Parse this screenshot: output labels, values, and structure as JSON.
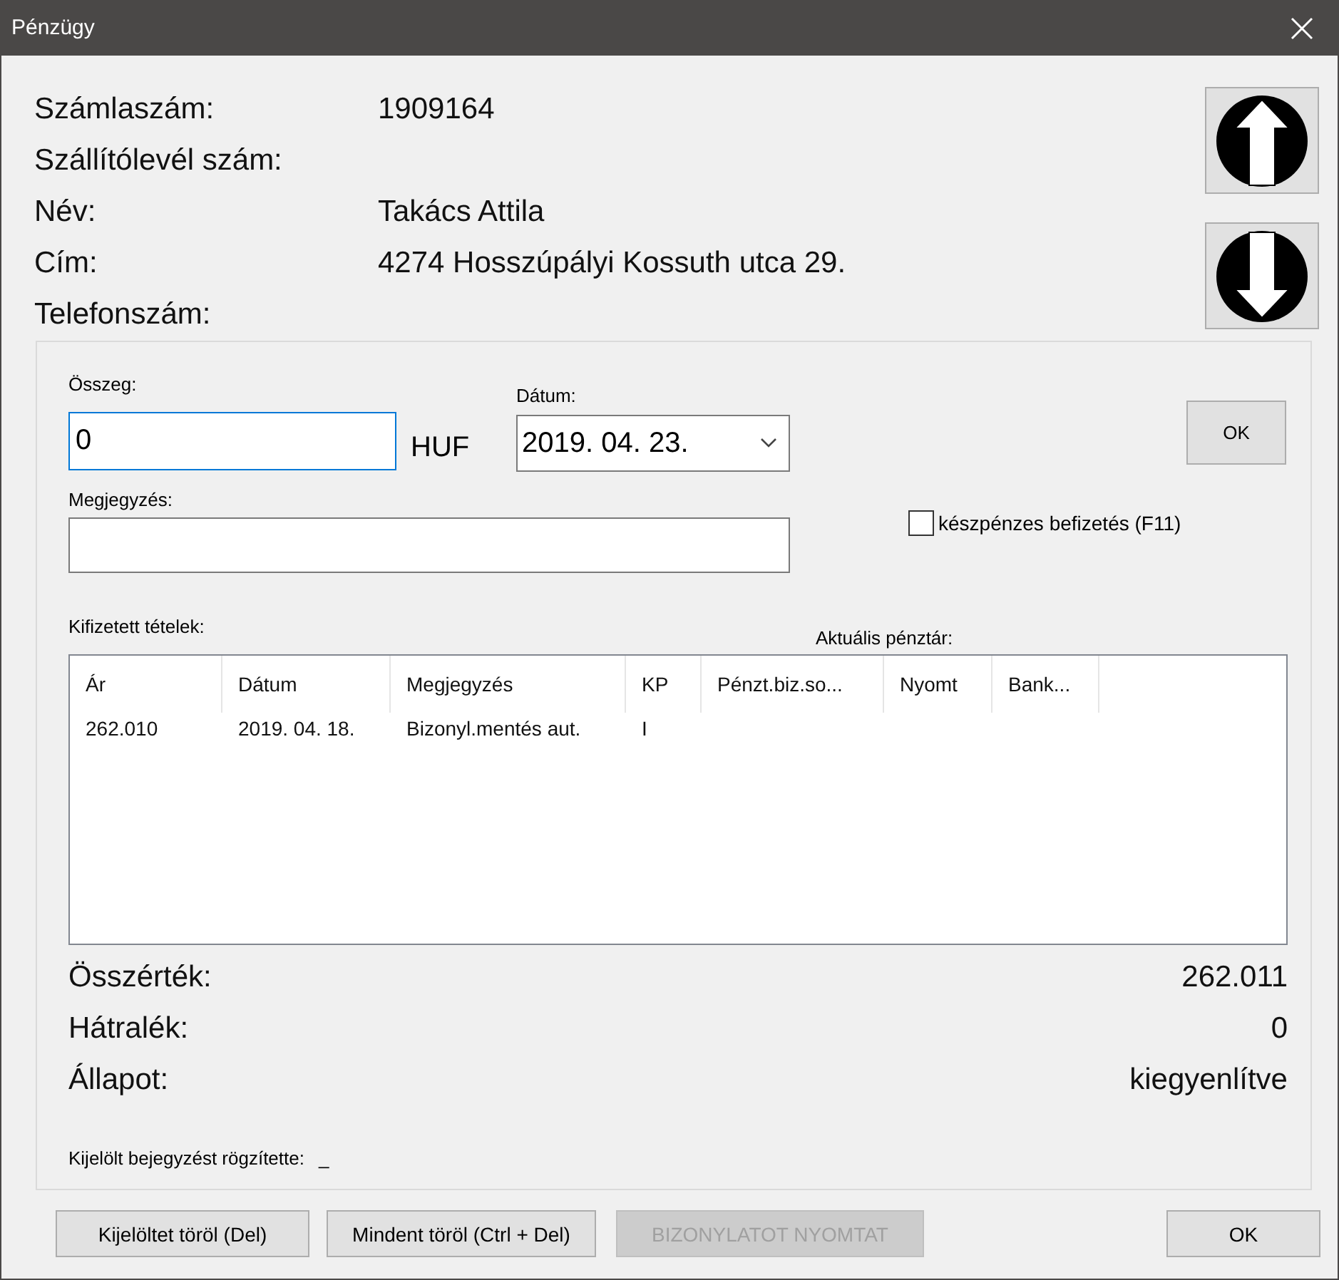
{
  "window": {
    "title": "Pénzügy"
  },
  "info": [
    {
      "label": "Számlaszám:",
      "value": "1909164"
    },
    {
      "label": "Szállítólevél szám:"
    },
    {
      "label": "Név:",
      "value": "Takács Attila"
    },
    {
      "label": "Cím:",
      "value": "4274 Hosszúpályi Kossuth utca 29."
    },
    {
      "label": "Telefonszám:"
    }
  ],
  "payment": {
    "amount_label": "Összeg:",
    "amount": "0",
    "currency": "HUF",
    "date_label": "Dátum:",
    "date": "2019. 04. 23.",
    "ok": "OK",
    "note_label": "Megjegyzés:",
    "cash": {
      "label": "készpénzes befizetés (F11)",
      "checked": false
    }
  },
  "paid_items": {
    "label": "Kifizetett tételek:",
    "register_label": "Aktuális pénztár:",
    "columns": [
      "Ár",
      "Dátum",
      "Megjegyzés",
      "KP",
      "Pénzt.biz.so...",
      "Nyomt",
      "Bank..."
    ],
    "rows": [
      [
        "262.010",
        "2019. 04. 18.",
        "Bizonyl.mentés aut.",
        "I",
        "",
        "",
        ""
      ]
    ]
  },
  "summary": [
    {
      "label": "Összérték:",
      "value": "262.011"
    },
    {
      "label": "Hátralék:",
      "value": "0"
    },
    {
      "label": "Állapot:",
      "value": "kiegyenlítve"
    }
  ],
  "recorded_by": {
    "label": "Kijelölt bejegyzést rögzítette:",
    "value": "_"
  },
  "buttons": [
    {
      "label": "Kijelöltet töröl (Del)",
      "disabled": false
    },
    {
      "label": "Mindent töröl (Ctrl + Del)",
      "disabled": false
    },
    {
      "label": "BIZONYLATOT NYOMTAT",
      "disabled": true
    },
    {
      "label": "OK",
      "disabled": false
    }
  ]
}
